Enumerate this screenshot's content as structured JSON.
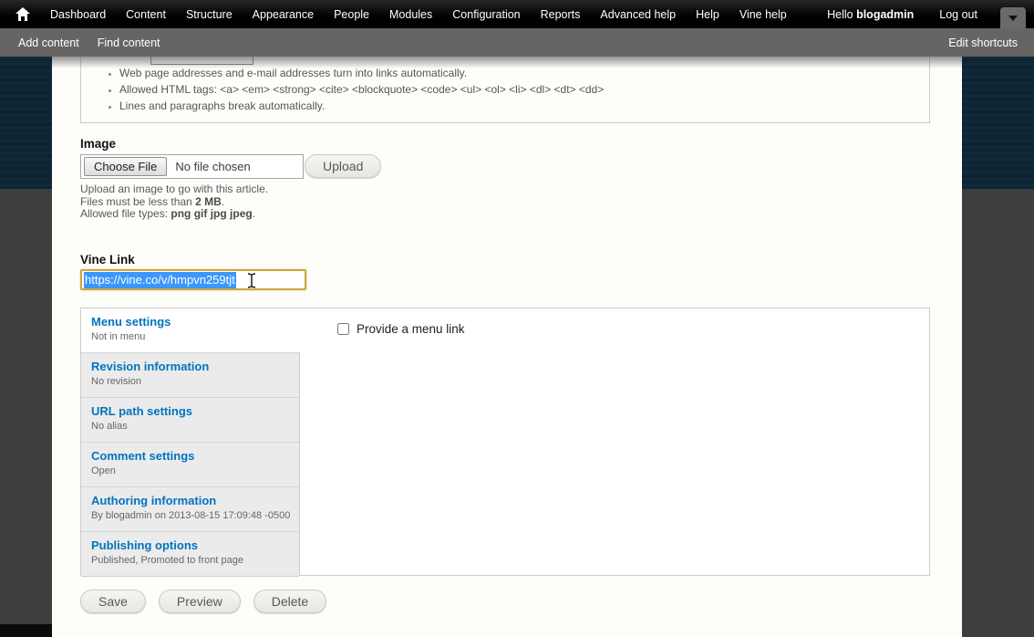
{
  "toolbar": {
    "items": [
      "Dashboard",
      "Content",
      "Structure",
      "Appearance",
      "People",
      "Modules",
      "Configuration",
      "Reports",
      "Advanced help",
      "Help",
      "Vine help"
    ],
    "greeting_prefix": "Hello ",
    "username": "blogadmin",
    "logout_label": "Log out"
  },
  "shortcut_bar": {
    "add_content": "Add content",
    "find_content": "Find content",
    "edit_shortcuts": "Edit shortcuts"
  },
  "filter_tips": {
    "items": [
      "Web page addresses and e-mail addresses turn into links automatically.",
      "Allowed HTML tags: <a> <em> <strong> <cite> <blockquote> <code> <ul> <ol> <li> <dl> <dt> <dd>",
      "Lines and paragraphs break automatically."
    ]
  },
  "image_field": {
    "label": "Image",
    "choose_file_label": "Choose File",
    "no_file_text": "No file chosen",
    "upload_label": "Upload",
    "desc_line1": "Upload an image to go with this article.",
    "desc_line2_prefix": "Files must be less than ",
    "desc_line2_bold": "2 MB",
    "desc_line2_suffix": ".",
    "desc_line3_prefix": "Allowed file types: ",
    "desc_line3_bold": "png gif jpg jpeg",
    "desc_line3_suffix": "."
  },
  "vine_field": {
    "label": "Vine Link",
    "value": "https://vine.co/v/hmpvn259tjt"
  },
  "vertical_tabs": [
    {
      "title": "Menu settings",
      "summary": "Not in menu"
    },
    {
      "title": "Revision information",
      "summary": "No revision"
    },
    {
      "title": "URL path settings",
      "summary": "No alias"
    },
    {
      "title": "Comment settings",
      "summary": "Open"
    },
    {
      "title": "Authoring information",
      "summary": "By blogadmin on 2013-08-15 17:09:48 -0500"
    },
    {
      "title": "Publishing options",
      "summary": "Published, Promoted to front page"
    }
  ],
  "menu_settings_pane": {
    "checkbox_label": "Provide a menu link",
    "checked": false
  },
  "actions": {
    "save": "Save",
    "preview": "Preview",
    "delete": "Delete"
  },
  "colors": {
    "toolbar_bg": "#000000",
    "shortcut_bg": "#666564",
    "overlay_navy": "#0c2433",
    "overlay_gray": "#3e3e3e",
    "tab_link": "#0074bd",
    "focus_border": "#d0a43c",
    "selection_bg": "#3b97fd"
  }
}
